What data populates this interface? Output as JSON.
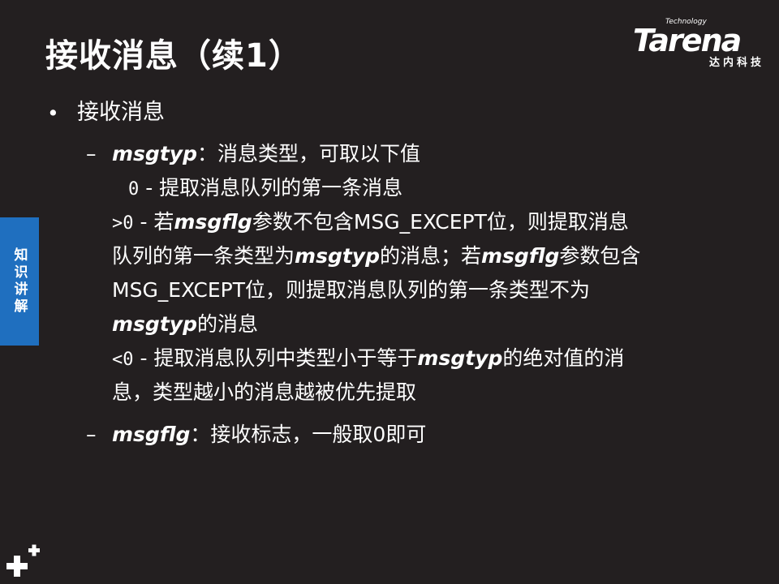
{
  "title": "接收消息（续1）",
  "logo": {
    "name": "Tarena",
    "tagline": "Technology",
    "subtitle": "达内科技"
  },
  "side_tab": {
    "label": "知识讲解"
  },
  "body": {
    "l1_bullet": "•",
    "l1_text": "接收消息",
    "item1_dash": "–",
    "item1_kw": "msgtyp",
    "item1_text": "：消息类型，可取以下值",
    "v0_code": "0",
    "v0_text": " - 提取消息队列的第一条消息",
    "gt_line1_code": ">0",
    "gt_line1_pre": " - 若",
    "gt_line1_kw": "msgflg",
    "gt_line1_post": "参数不包含MSG_EXCEPT位，则提取消息",
    "gt_line2_pre": "队列的第一条类型为",
    "gt_line2_kw1": "msgtyp",
    "gt_line2_mid": "的消息；若",
    "gt_line2_kw2": "msgflg",
    "gt_line2_post": "参数包含",
    "gt_line3": "MSG_EXCEPT位，则提取消息队列的第一条类型不为",
    "gt_line4_kw": "msgtyp",
    "gt_line4_post": "的消息",
    "lt_line1_code": "<0",
    "lt_line1_pre": " - 提取消息队列中类型小于等于",
    "lt_line1_kw": "msgtyp",
    "lt_line1_post": "的绝对值的消",
    "lt_line2": "息，类型越小的消息越被优先提取",
    "item2_dash": "–",
    "item2_kw": "msgflg",
    "item2_text": "：接收标志，一般取0即可"
  }
}
